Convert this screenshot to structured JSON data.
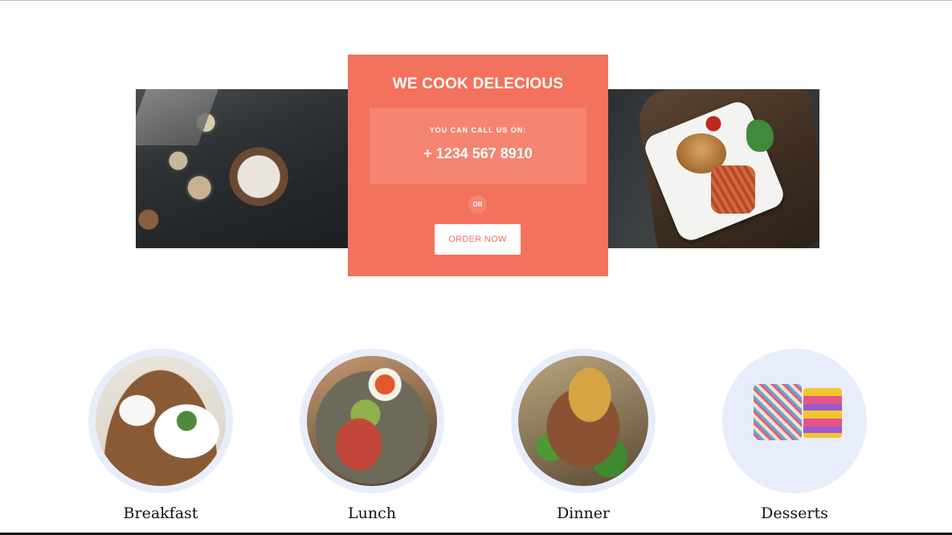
{
  "hero": {
    "left_image": "dessert-flatlay-image",
    "right_image": "burger-plate-image"
  },
  "card": {
    "title": "WE COOK DELECIOUS",
    "call_label": "YOU CAN CALL US ON:",
    "phone": "+ 1234 567 8910",
    "or_label": "OR",
    "order_button_label": "ORDER NOW"
  },
  "categories": [
    {
      "label": "Breakfast",
      "image": "breakfast-image"
    },
    {
      "label": "Lunch",
      "image": "lunch-image"
    },
    {
      "label": "Dinner",
      "image": "dinner-image"
    },
    {
      "label": "Desserts",
      "image": "desserts-image"
    }
  ],
  "colors": {
    "accent": "#f2725d",
    "accent_light": "#f58471",
    "circle_ring": "#e8edfb",
    "text_dark": "#111111"
  }
}
